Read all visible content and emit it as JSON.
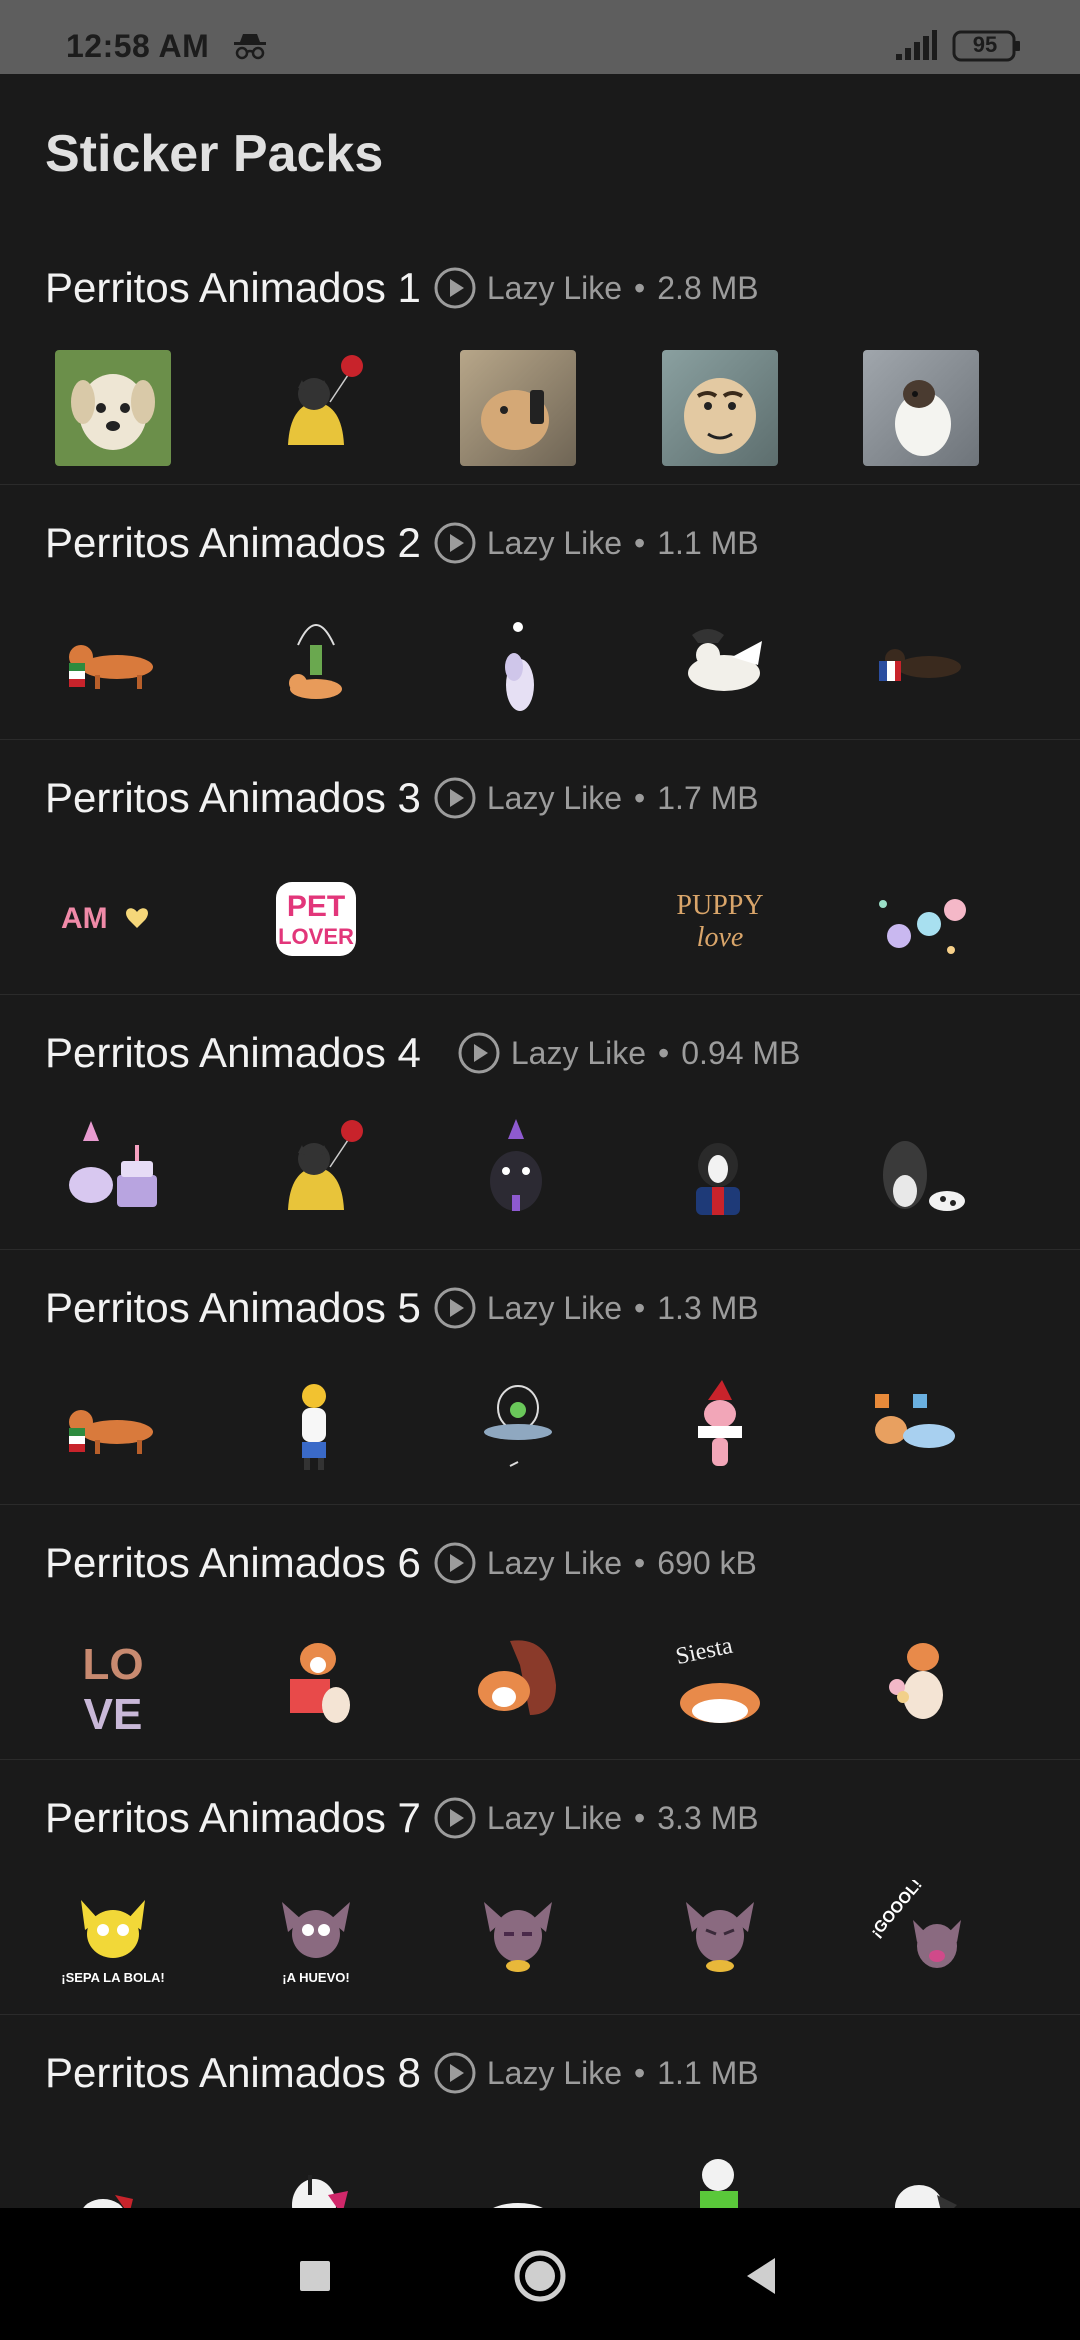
{
  "status_bar": {
    "time": "12:58 AM",
    "battery": "95"
  },
  "title": "Sticker Packs",
  "packs": [
    {
      "name": "Perritos Animados 1",
      "author": "Lazy Like",
      "size": "2.8 MB"
    },
    {
      "name": "Perritos Animados 2",
      "author": "Lazy Like",
      "size": "1.1 MB"
    },
    {
      "name": "Perritos Animados 3",
      "author": "Lazy Like",
      "size": "1.7 MB"
    },
    {
      "name": "Perritos Animados 4",
      "author": "Lazy Like",
      "size": "0.94 MB"
    },
    {
      "name": "Perritos Animados 5",
      "author": "Lazy Like",
      "size": "1.3 MB"
    },
    {
      "name": "Perritos Animados 6",
      "author": "Lazy Like",
      "size": "690 kB"
    },
    {
      "name": "Perritos Animados 7",
      "author": "Lazy Like",
      "size": "3.3 MB"
    },
    {
      "name": "Perritos Animados 8",
      "author": "Lazy Like",
      "size": "1.1 MB"
    }
  ],
  "sticker_text": {
    "pack3_am": "AM",
    "pack3_pet": "PET",
    "pack3_lover": "LOVER",
    "pack3_puppy": "PUPPY",
    "pack3_love": "love",
    "pack6_lo": "LO",
    "pack6_ve": "VE",
    "pack6_siesta": "Siesta",
    "pack7_sepa": "¡SEPA LA BOLA!",
    "pack7_huevo": "¡A HUEVO!",
    "pack7_goool": "¡GOOOL!"
  },
  "colors": {
    "background": "#1a1a1a",
    "status_bar": "#5e5e5e",
    "nav_bar": "#000000"
  }
}
